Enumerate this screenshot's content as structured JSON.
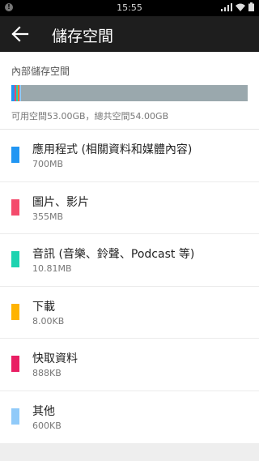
{
  "status_bar": {
    "time": "15:55"
  },
  "app_bar": {
    "title": "儲存空間"
  },
  "internal": {
    "label": "內部儲存空間",
    "summary": "可用空間53.00GB，總共空間54.00GB",
    "segments": [
      {
        "color": "#2196f3",
        "fraction": 0.013
      },
      {
        "color": "#f44b6c",
        "fraction": 0.007
      },
      {
        "color": "#1dd3b0",
        "fraction": 0.006
      },
      {
        "color": "#ffb300",
        "fraction": 0.005
      },
      {
        "color": "#e91e63",
        "fraction": 0.005
      },
      {
        "color": "#90caf9",
        "fraction": 0.006
      }
    ],
    "free_color": "#9aa8ad"
  },
  "categories": [
    {
      "name": "應用程式 (相關資料和媒體內容)",
      "size": "700MB",
      "color": "#2196f3"
    },
    {
      "name": "圖片、影片",
      "size": "355MB",
      "color": "#f44b6c"
    },
    {
      "name": "音訊 (音樂、鈴聲、Podcast 等)",
      "size": "10.81MB",
      "color": "#1dd3b0"
    },
    {
      "name": "下載",
      "size": "8.00KB",
      "color": "#ffb300"
    },
    {
      "name": "快取資料",
      "size": "888KB",
      "color": "#e91e63"
    },
    {
      "name": "其他",
      "size": "600KB",
      "color": "#90caf9"
    }
  ]
}
